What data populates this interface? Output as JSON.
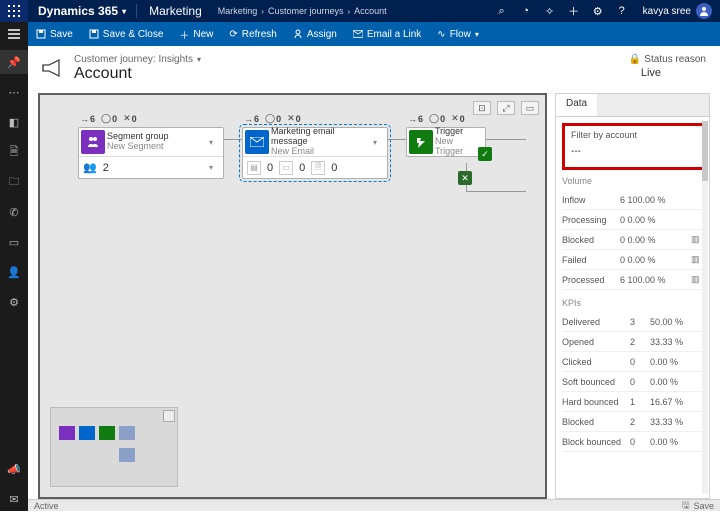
{
  "topbar": {
    "app": "Dynamics 365",
    "area": "Marketing",
    "breadcrumb": [
      "Marketing",
      "Customer journeys",
      "Account"
    ],
    "user": "kavya sree"
  },
  "cmd": {
    "save": "Save",
    "saveclose": "Save & Close",
    "new": "New",
    "refresh": "Refresh",
    "assign": "Assign",
    "email": "Email a Link",
    "flow": "Flow"
  },
  "header": {
    "sub": "Customer journey: Insights",
    "title": "Account",
    "status_label": "Status reason",
    "status_value": "Live"
  },
  "tiles": {
    "t1": {
      "stats": [
        "6",
        "0",
        "0"
      ],
      "title": "Segment group",
      "sub": "New Segment",
      "badge": "2"
    },
    "t2": {
      "stats": [
        "6",
        "0",
        "0"
      ],
      "title": "Marketing email message",
      "sub": "New Email",
      "b1": "0",
      "b2": "0",
      "b3": "0"
    },
    "t3": {
      "stats": [
        "6",
        "0",
        "0"
      ],
      "title": "Trigger",
      "sub": "New Trigger"
    }
  },
  "panel": {
    "tab": "Data",
    "filter_label": "Filter by account",
    "filter_value": "---",
    "volume_title": "Volume",
    "kpi_title": "KPIs",
    "volume": [
      {
        "label": "Inflow",
        "val": "6",
        "pct": "100.00 %",
        "icon": false
      },
      {
        "label": "Processing",
        "val": "0",
        "pct": "0.00 %",
        "icon": false
      },
      {
        "label": "Blocked",
        "val": "0",
        "pct": "0.00 %",
        "icon": true
      },
      {
        "label": "Failed",
        "val": "0",
        "pct": "0.00 %",
        "icon": true
      },
      {
        "label": "Processed",
        "val": "6",
        "pct": "100.00 %",
        "icon": true
      }
    ],
    "kpis": [
      {
        "label": "Delivered",
        "n": "3",
        "pct": "50.00 %"
      },
      {
        "label": "Opened",
        "n": "2",
        "pct": "33.33 %"
      },
      {
        "label": "Clicked",
        "n": "0",
        "pct": "0.00 %"
      },
      {
        "label": "Soft bounced",
        "n": "0",
        "pct": "0.00 %"
      },
      {
        "label": "Hard bounced",
        "n": "1",
        "pct": "16.67 %"
      },
      {
        "label": "Blocked",
        "n": "2",
        "pct": "33.33 %"
      },
      {
        "label": "Block bounced",
        "n": "0",
        "pct": "0.00 %"
      }
    ]
  },
  "footer": {
    "status": "Active",
    "save": "Save"
  }
}
